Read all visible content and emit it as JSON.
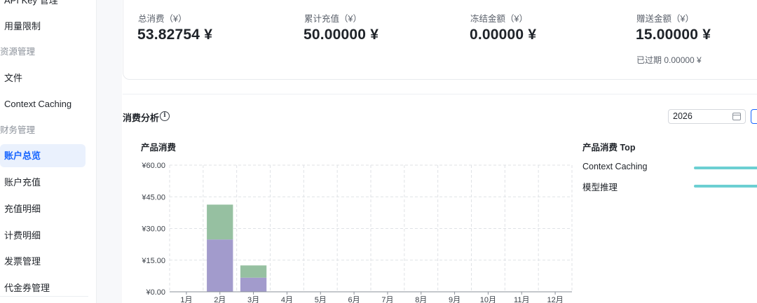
{
  "sidebar": {
    "items": [
      {
        "label": "API Key 管理",
        "type": "item",
        "active": false
      },
      {
        "label": "用量限制",
        "type": "item",
        "active": false
      },
      {
        "label": "资源管理",
        "type": "group"
      },
      {
        "label": "文件",
        "type": "item",
        "active": false
      },
      {
        "label": "Context Caching",
        "type": "item",
        "active": false
      },
      {
        "label": "财务管理",
        "type": "group"
      },
      {
        "label": "账户总览",
        "type": "item",
        "active": true
      },
      {
        "label": "账户充值",
        "type": "item",
        "active": false
      },
      {
        "label": "充值明细",
        "type": "item",
        "active": false
      },
      {
        "label": "计费明细",
        "type": "item",
        "active": false
      },
      {
        "label": "发票管理",
        "type": "item",
        "active": false
      },
      {
        "label": "代金券管理",
        "type": "item",
        "active": false
      }
    ]
  },
  "stats": [
    {
      "label": "总消费（¥）",
      "value": "53.82754 ¥"
    },
    {
      "label": "累计充值（¥）",
      "value": "50.00000 ¥"
    },
    {
      "label": "冻结金额（¥）",
      "value": "0.00000 ¥"
    },
    {
      "label": "赠送金额（¥）",
      "value": "15.00000 ¥",
      "sub": "已过期 0.00000 ¥"
    }
  ],
  "analysis": {
    "title": "消费分析",
    "year": "2026",
    "chart_title": "产品消费",
    "top_title": "产品消费 Top",
    "top_items": [
      {
        "label": "Context Caching"
      },
      {
        "label": "模型推理"
      }
    ]
  },
  "colors": {
    "accent": "#1664ff",
    "series_a": "#a29bcc",
    "series_b": "#96c0a1",
    "top_bar": "#6ccfd2"
  },
  "chart_data": {
    "type": "bar",
    "stacked": true,
    "categories": [
      "1月",
      "2月",
      "3月",
      "4月",
      "5月",
      "6月",
      "7月",
      "8月",
      "9月",
      "10月",
      "11月",
      "12月"
    ],
    "series": [
      {
        "values": [
          0,
          24.8,
          6.7,
          0,
          0,
          0,
          0,
          0,
          0,
          0,
          0,
          0
        ],
        "color": "#a29bcc"
      },
      {
        "values": [
          0,
          16.5,
          5.8,
          0,
          0,
          0,
          0,
          0,
          0,
          0,
          0,
          0
        ],
        "color": "#96c0a1"
      }
    ],
    "yticks": [
      "¥0.00",
      "¥15.00",
      "¥30.00",
      "¥45.00",
      "¥60.00"
    ],
    "ylim": [
      0,
      60
    ],
    "grid": true
  }
}
